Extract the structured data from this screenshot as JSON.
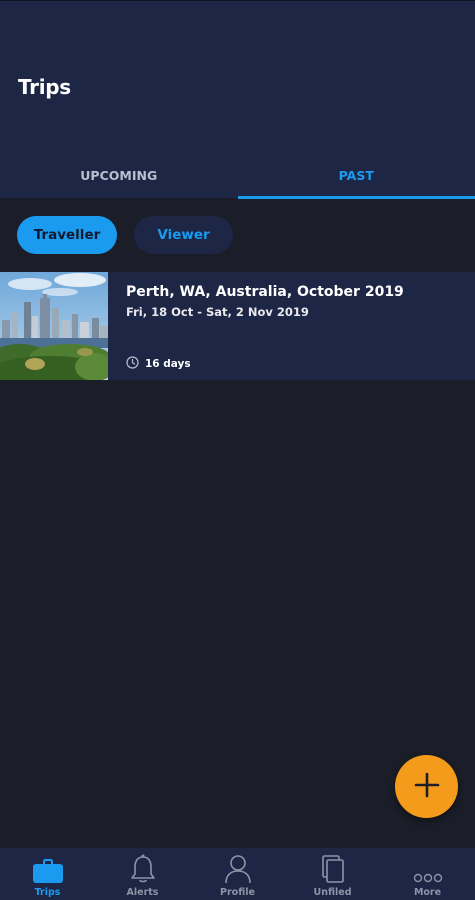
{
  "header": {
    "title": "Trips"
  },
  "tabs": [
    {
      "label": "UPCOMING",
      "active": false
    },
    {
      "label": "PAST",
      "active": true
    }
  ],
  "roles": {
    "traveller": "Traveller",
    "viewer": "Viewer"
  },
  "trips": [
    {
      "title": "Perth, WA, Australia, October 2019",
      "dates": "Fri, 18 Oct - Sat, 2 Nov 2019",
      "duration": "16 days"
    }
  ],
  "fab": {
    "icon": "plus-icon"
  },
  "bottom_nav": [
    {
      "label": "Trips",
      "icon": "briefcase-icon",
      "active": true
    },
    {
      "label": "Alerts",
      "icon": "bell-icon",
      "active": false
    },
    {
      "label": "Profile",
      "icon": "person-icon",
      "active": false
    },
    {
      "label": "Unfiled",
      "icon": "documents-icon",
      "active": false
    },
    {
      "label": "More",
      "icon": "more-dots-icon",
      "active": false
    }
  ],
  "colors": {
    "accent": "#1a9bf0",
    "header_bg": "#1d2644",
    "page_bg": "#1b1e28",
    "fab": "#f59b1c"
  }
}
